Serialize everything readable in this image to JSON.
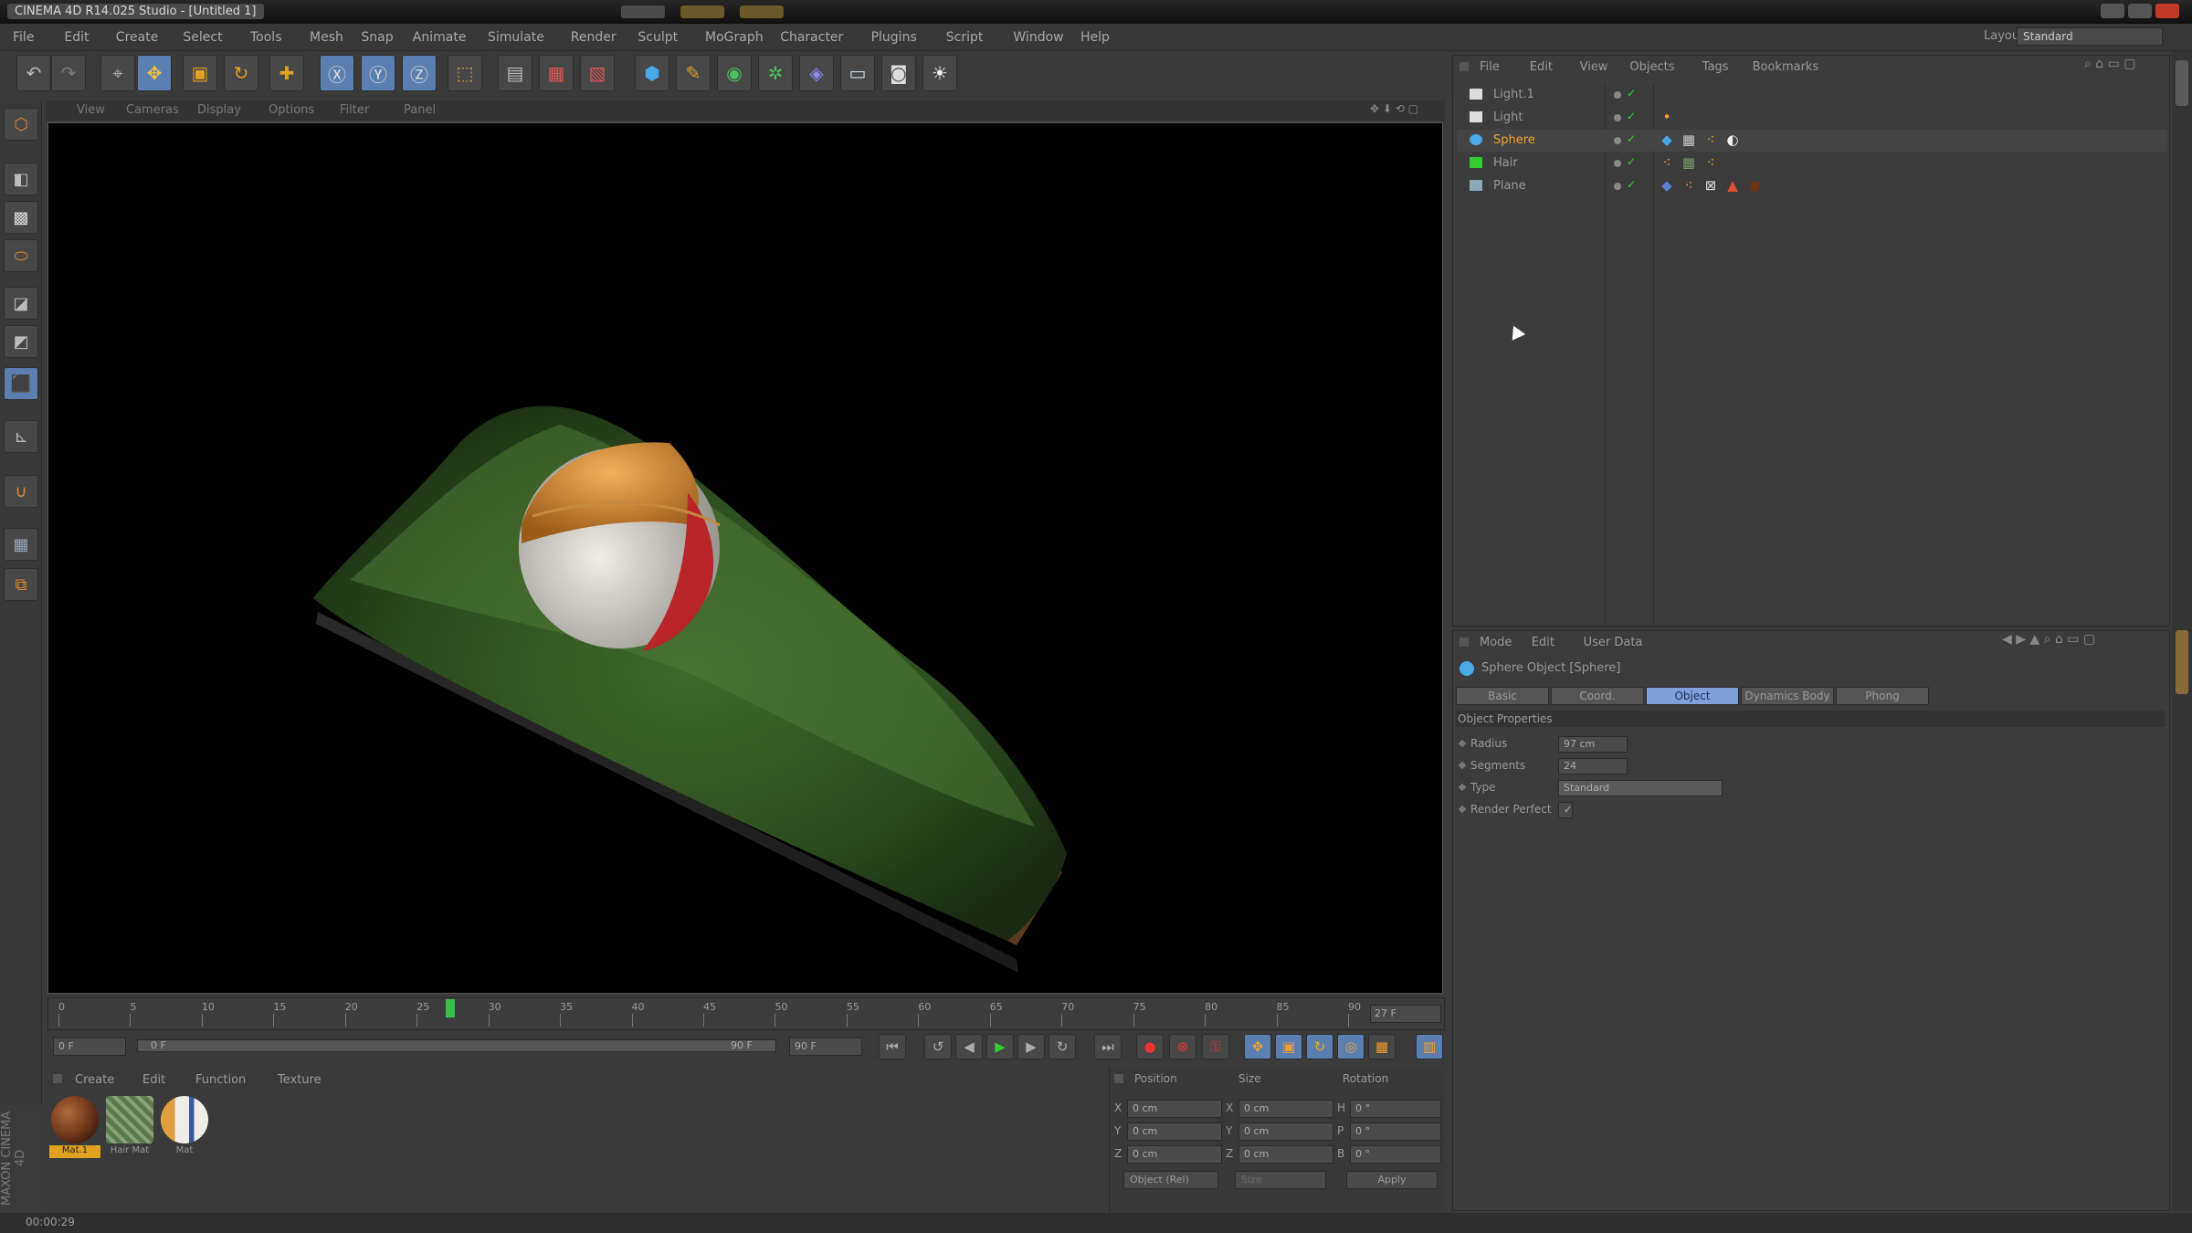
{
  "app": {
    "title": "CINEMA 4D R14.025 Studio - [Untitled 1]",
    "layout_label": "Layout:",
    "layout_value": "Standard"
  },
  "menu": [
    "File",
    "Edit",
    "Create",
    "Select",
    "Tools",
    "Mesh",
    "Snap",
    "Animate",
    "Simulate",
    "Render",
    "Sculpt",
    "MoGraph",
    "Character",
    "Plugins",
    "Script",
    "Window",
    "Help"
  ],
  "viewport": {
    "menu": [
      "View",
      "Cameras",
      "Display",
      "Options",
      "Filter",
      "Panel"
    ]
  },
  "timeline": {
    "ticks": [
      "0",
      "5",
      "10",
      "15",
      "20",
      "25",
      "30",
      "35",
      "40",
      "45",
      "50",
      "55",
      "60",
      "65",
      "70",
      "75",
      "80",
      "85",
      "90"
    ],
    "current_frame": "27",
    "frame_field": "27 F"
  },
  "transport": {
    "start": "0 F",
    "range_start": "0 F",
    "range_end": "90 F",
    "end": "90 F"
  },
  "material_manager": {
    "menu": [
      "Create",
      "Edit",
      "Function",
      "Texture"
    ],
    "materials": [
      {
        "label": "Mat.1",
        "color": "#6b3418"
      },
      {
        "label": "Hair Mat",
        "color": "#5a7a4a"
      },
      {
        "label": "Mat",
        "color": "#d8d0c0"
      }
    ]
  },
  "coordinates": {
    "headers": [
      "Position",
      "Size",
      "Rotation"
    ],
    "rows": [
      {
        "axis": "X",
        "pos": "0 cm",
        "size_axis": "X",
        "size": "0 cm",
        "rot_axis": "H",
        "rot": "0 °"
      },
      {
        "axis": "Y",
        "pos": "0 cm",
        "size_axis": "Y",
        "size": "0 cm",
        "rot_axis": "P",
        "rot": "0 °"
      },
      {
        "axis": "Z",
        "pos": "0 cm",
        "size_axis": "Z",
        "size": "0 cm",
        "rot_axis": "B",
        "rot": "0 °"
      }
    ],
    "mode": "Object (Rel)",
    "size_mode": "Size",
    "apply": "Apply"
  },
  "object_manager": {
    "menu": [
      "File",
      "Edit",
      "View",
      "Objects",
      "Tags",
      "Bookmarks"
    ],
    "objects": [
      {
        "name": "Light.1",
        "selected": false
      },
      {
        "name": "Light",
        "selected": false
      },
      {
        "name": "Sphere",
        "selected": true
      },
      {
        "name": "Hair",
        "selected": false
      },
      {
        "name": "Plane",
        "selected": false
      }
    ]
  },
  "attributes": {
    "menu": [
      "Mode",
      "Edit",
      "User Data"
    ],
    "object_title": "Sphere Object [Sphere]",
    "tabs": [
      "Basic",
      "Coord.",
      "Object",
      "Dynamics Body",
      "Phong"
    ],
    "active_tab": "Object",
    "section": "Object Properties",
    "props": [
      {
        "label": "Radius",
        "value": "97 cm"
      },
      {
        "label": "Segments",
        "value": "24"
      },
      {
        "label": "Type",
        "value": "Standard"
      },
      {
        "label": "Render Perfect",
        "value": "✓"
      }
    ]
  },
  "status": {
    "text": "00:00:29",
    "branding": "MAXON CINEMA 4D"
  }
}
